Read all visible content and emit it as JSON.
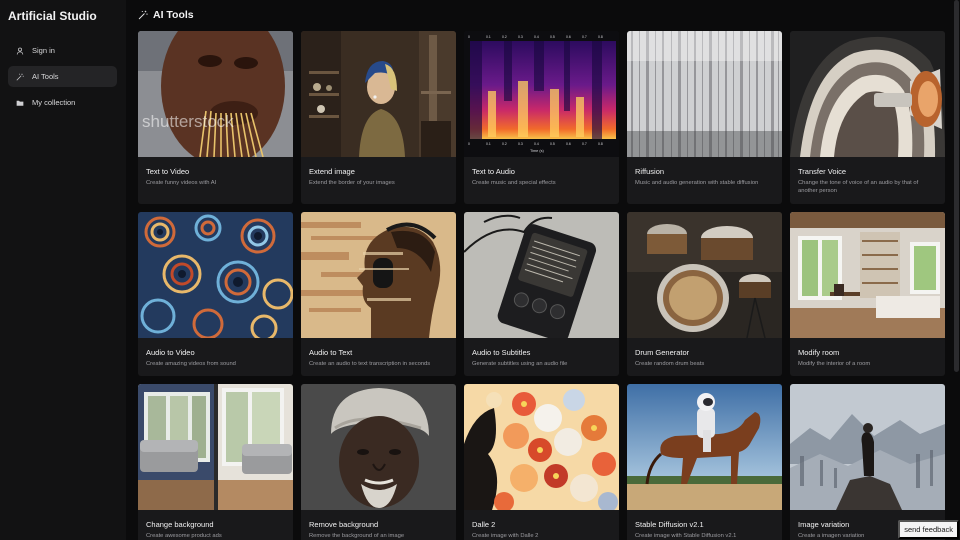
{
  "app": {
    "title": "Artificial Studio"
  },
  "sidebar": {
    "items": [
      {
        "label": "Sign in",
        "icon": "user-icon",
        "active": false
      },
      {
        "label": "AI Tools",
        "icon": "magic-wand-icon",
        "active": true
      },
      {
        "label": "My collection",
        "icon": "folder-icon",
        "active": false
      }
    ]
  },
  "page": {
    "title": "AI Tools",
    "icon": "magic-wand-icon"
  },
  "tools": [
    {
      "title": "Text to Video",
      "desc": "Create funny videos with AI",
      "image": "man-eating-spaghetti",
      "watermark": "shutterstock"
    },
    {
      "title": "Extend image",
      "desc": "Extend the border of your images",
      "image": "girl-with-pearl-earring-extended"
    },
    {
      "title": "Text to Audio",
      "desc": "Create music and special effects",
      "image": "spectrogram",
      "xlabel": "Time (s)"
    },
    {
      "title": "Riffusion",
      "desc": "Music and audio generation with stable diffusion",
      "image": "grayscale-spectrogram"
    },
    {
      "title": "Transfer Voice",
      "desc": "Change the tone of voice of an audio by that of another person",
      "image": "abstract-horn"
    },
    {
      "title": "Audio to Video",
      "desc": "Create amazing videos from sound",
      "image": "psychedelic-pattern"
    },
    {
      "title": "Audio to Text",
      "desc": "Create an audio to text transcription in seconds",
      "image": "glitch-headphones-portrait"
    },
    {
      "title": "Audio to Subtitles",
      "desc": "Generate subtitles using an audio file",
      "image": "audio-player-device"
    },
    {
      "title": "Drum Generator",
      "desc": "Create random drum beats",
      "image": "drum-kit"
    },
    {
      "title": "Modify room",
      "desc": "Modify the interior of a room",
      "image": "bedroom-interior"
    },
    {
      "title": "Change background",
      "desc": "Create awesome product ads",
      "image": "sofa-split-room"
    },
    {
      "title": "Remove background",
      "desc": "Remove the background of an image",
      "image": "man-with-turban"
    },
    {
      "title": "Dalle 2",
      "desc": "Create image with Dalle 2",
      "image": "flower-head-silhouette"
    },
    {
      "title": "Stable Diffusion v2.1",
      "desc": "Create image with Stable Diffusion v2.1",
      "image": "astronaut-on-horse"
    },
    {
      "title": "Image variation",
      "desc": "Create a imagen variation",
      "image": "wanderer-above-fog"
    }
  ],
  "feedback": {
    "label": "send feedback"
  },
  "colors": {
    "background": "#0b0b0c",
    "sidebar": "#121213",
    "card": "#19191b",
    "active": "#242426"
  }
}
